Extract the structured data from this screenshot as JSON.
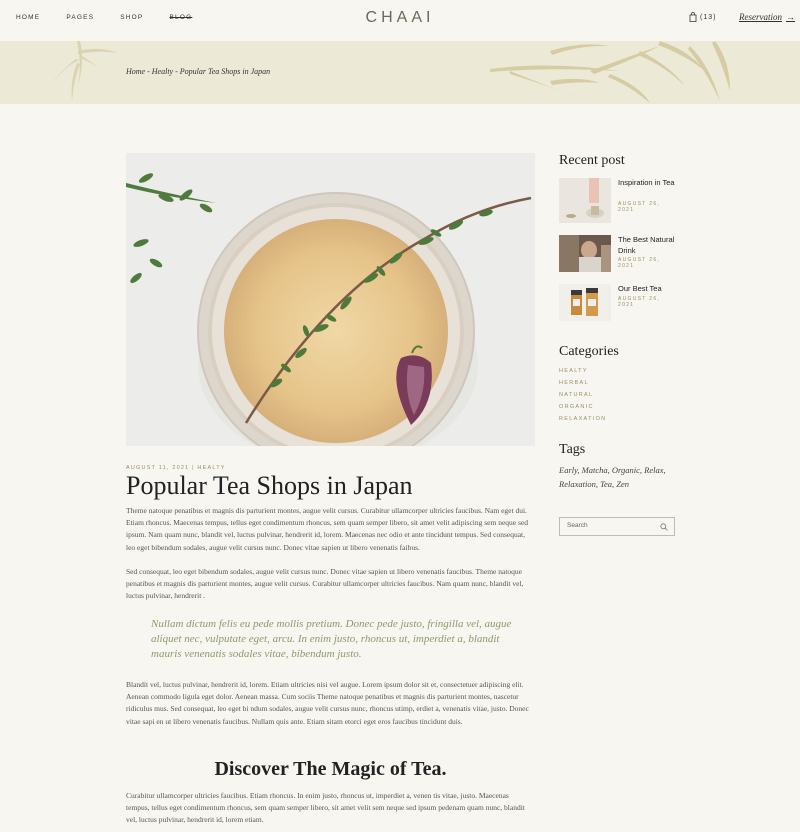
{
  "nav": {
    "items": [
      "HOME",
      "PAGES",
      "SHOP",
      "BLOG"
    ],
    "logo": "CHAAI",
    "cart_count": "(13)",
    "reservation": "Reservation",
    "reservation_arrow": "→"
  },
  "banner": {
    "breadcrumb": "Home - Healty - Popular Tea Shops in Japan"
  },
  "post": {
    "meta": "AUGUST 11, 2021 | HEALTY",
    "title": "Popular Tea Shops in Japan",
    "p1": "Theme natoque penatibus et magnis dis parturient montes, augue velit cursus. Curabitur ullamcorper ultricies faucibus. Nam eget dui. Etiam rhoncus. Maecenas tempus, tellus eget condimentum rhoncus, sem quam semper libero, sit amet velit adipiscing sem neque sed ipsum. Nam quam nunc, blandit vel, luctus pulvinar, hendrerit id, lorem. Maecenas nec odio et ante tincidunt tempus. Sed consequat, leo eget bibendum sodales, augue velit cursus nunc. Donec vitae sapien ut libero venenatis faibus.",
    "p2": "Sed consequat, leo eget bibendum sodales, augue velit cursus nunc. Donec vitae sapien ut libero venenatis faucibus. Theme natoque penatibus et magnis dis parturient montes, augue velit cursus. Curabitur ullamcorper ultricies faucibus. Nam quam nunc, blandit vel, luctus pulvinar, hendrerit .",
    "quote": "Nullam dictum felis eu pede mollis pretium. Donec pede justo, fringilla vel, augue aliquet nec, vulputate eget, arcu. In enim justo, rhoncus ut, imperdiet a, blandit mauris venenatis sodales vitae, bibendum justo.",
    "p3": "Blandit vel, luctus pulvinar, hendrerit id, lorem. Etiam ultricies nisi vel augue. Lorem ipsum dolor sit et, consectetuer adipiscing elit. Aenean commodo ligula eget dolor. Aenean massa. Cum sociis Theme natoque penatibus et magnis dis parturient montes, nascetur ridiculus mus. Sed consequat, leo eget bi ndum sodales, augue velit cursus nunc, rhoncus utimp, erdiet a, venenatis vitae, justo. Donec vitae sapi en ut libero venenatis faucibus. Nullam quis ante. Etiam sitam etorci eget eros faucibus tincidunt duis.",
    "subhead": "Discover The Magic of Tea.",
    "p4": "Curabitur ullamcorper ultricies faucibus. Etiam rhoncus. In enim justo, rhoncus ut, imperdiet a, venen tis vitae, justo. Maecenas tempus, tellus eget condimentum rhoncus, sem quam semper libero, sit amet velit sem neque sed ipsum pedenam quam nunc, blandit vel, luctus pulvinar, hendrerit id, lorem etiam."
  },
  "sidebar": {
    "recent_heading": "Recent post",
    "recent": [
      {
        "title": "Inspiration in Tea",
        "date": "AUGUST 26, 2021"
      },
      {
        "title": "The Best Natural Drink",
        "date": "AUGUST 26, 2021"
      },
      {
        "title": "Our Best Tea",
        "date": "AUGUST 26, 2021"
      }
    ],
    "categories_heading": "Categories",
    "categories": [
      "HEALTY",
      "HERBAL",
      "NATURAL",
      "ORGANIC",
      "RELAXATION"
    ],
    "tags_heading": "Tags",
    "tags": "Early, Matcha, Organic, Relax, Relaxation, Tea, Zen",
    "search_placeholder": "Search"
  },
  "colors": {
    "background": "#f7f6f1",
    "banner": "#ece9d6",
    "accent": "#9a8f63",
    "quote": "#8d9a6a"
  }
}
